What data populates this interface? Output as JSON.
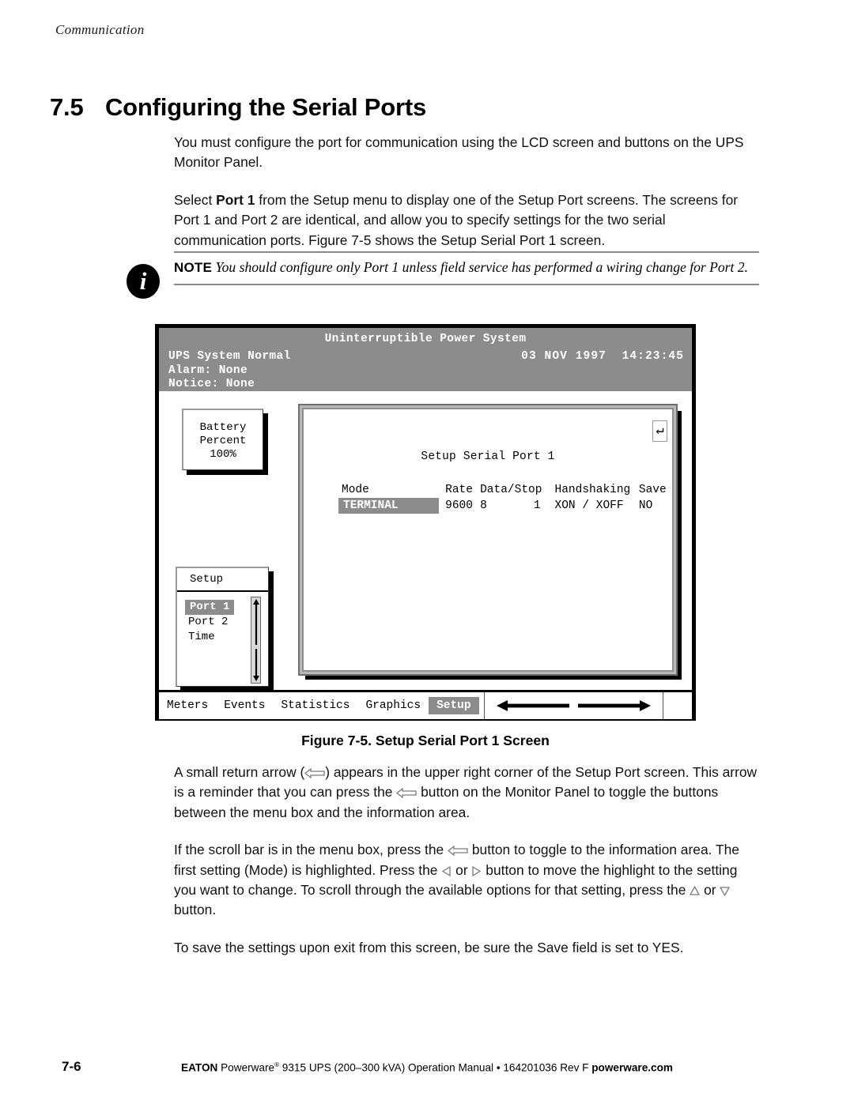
{
  "running_head": "Communication",
  "section": {
    "number": "7.5",
    "title": "Configuring the Serial Ports"
  },
  "paragraphs": {
    "p1": "You must configure the port for communication using the LCD screen and buttons on the UPS Monitor Panel.",
    "p2_pre": "Select ",
    "p2_bold": "Port 1",
    "p2_post": " from the Setup menu to display one of the Setup Port screens. The screens for Port 1 and Port 2 are identical, and allow you to specify settings for the two serial communication ports. Figure 7-5 shows the Setup Serial Port 1 screen.",
    "p3_a": "A small return arrow (",
    "p3_b": ") appears in the upper right corner of the Setup Port screen. This arrow is a reminder that you can press the ",
    "p3_c": " button on the Monitor Panel to toggle the buttons between the menu box and the information area.",
    "p4_a": "If the scroll bar is in the menu box, press the ",
    "p4_b": " button to toggle to the information area. The first setting (Mode) is highlighted. Press the ",
    "p4_c": " or ",
    "p4_d": " button to move the highlight to the setting you want to change. To scroll through the available options for that setting, press the ",
    "p4_e": " or ",
    "p4_f": " button.",
    "p5": "To save the settings upon exit from this screen, be sure the Save field is set to YES."
  },
  "note": {
    "icon": "info-icon",
    "label": "NOTE",
    "text": "You should configure only Port 1 unless field service has performed a wiring change for Port 2."
  },
  "lcd": {
    "title": "Uninterruptible Power System",
    "status_line1": "UPS System Normal",
    "status_line2": "Alarm:  None",
    "status_line3": "Notice: None",
    "date": "03 NOV 1997",
    "time": "14:23:45",
    "battery": {
      "line1": "Battery",
      "line2": "Percent",
      "line3": "100%"
    },
    "menu": {
      "title": "Setup",
      "items": [
        {
          "label": "Port 1",
          "selected": true
        },
        {
          "label": "Port 2",
          "selected": false
        },
        {
          "label": "Time",
          "selected": false
        }
      ],
      "scrollbar": "vertical-scrollbar"
    },
    "info": {
      "return_arrow": "return-arrow-icon",
      "title": "Setup Serial Port 1",
      "headers": [
        "Mode",
        "Rate",
        "Data/Stop",
        "Handshaking",
        "Save"
      ],
      "header_mode": "Mode",
      "header_rate": "Rate",
      "header_data": "Data/Stop",
      "header_hand": "Handshaking",
      "header_save": "Save",
      "value_mode": "TERMINAL",
      "value_rate": "9600",
      "value_data": "8",
      "value_stop": "1",
      "value_hand": "XON / XOFF",
      "value_save": "NO"
    },
    "tabs": [
      {
        "label": "Meters",
        "selected": false
      },
      {
        "label": "Events",
        "selected": false
      },
      {
        "label": "Statistics",
        "selected": false
      },
      {
        "label": "Graphics",
        "selected": false
      },
      {
        "label": "Setup",
        "selected": true
      }
    ],
    "tab_arrow_left": "arrow-left-icon",
    "tab_arrow_right": "arrow-right-icon"
  },
  "figure": {
    "caption": "Figure 7-5. Setup Serial Port 1 Screen"
  },
  "footer": {
    "page_number": "7-6",
    "brand": "EATON",
    "product": " Powerware",
    "registered": "®",
    "manual": " 9315 UPS (200–300 kVA) Operation Manual  •  164201036 Rev F  ",
    "website": "powerware.com"
  },
  "colors": {
    "lcd_gray": "#8c8c8c",
    "lcd_frame": "#000000",
    "rule_gray": "#8a8a8a"
  }
}
